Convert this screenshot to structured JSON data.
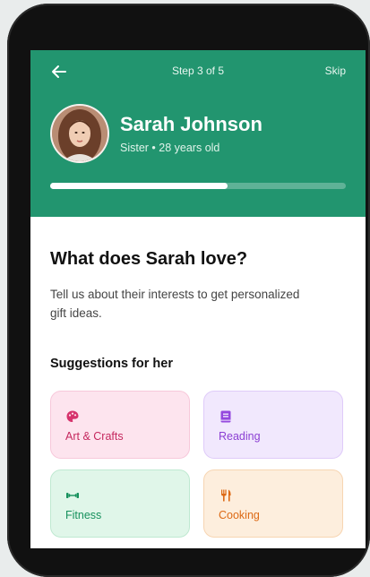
{
  "header": {
    "step_label": "Step 3 of 5",
    "skip_label": "Skip",
    "name": "Sarah Johnson",
    "subtitle": "Sister • 28 years old",
    "progress": 0.6
  },
  "main": {
    "question": "What does Sarah love?",
    "description": "Tell us about their interests to get personalized gift ideas.",
    "section_title": "Suggestions for her",
    "cards": [
      {
        "label": "Art & Crafts",
        "icon": "palette-icon",
        "color": "#c5285e"
      },
      {
        "label": "Reading",
        "icon": "book-icon",
        "color": "#8b3fd3"
      },
      {
        "label": "Fitness",
        "icon": "dumbbell-icon",
        "color": "#17915d"
      },
      {
        "label": "Cooking",
        "icon": "utensils-icon",
        "color": "#dd6a15"
      }
    ]
  },
  "colors": {
    "header_bg": "#22956f",
    "text_dark": "#111111"
  }
}
